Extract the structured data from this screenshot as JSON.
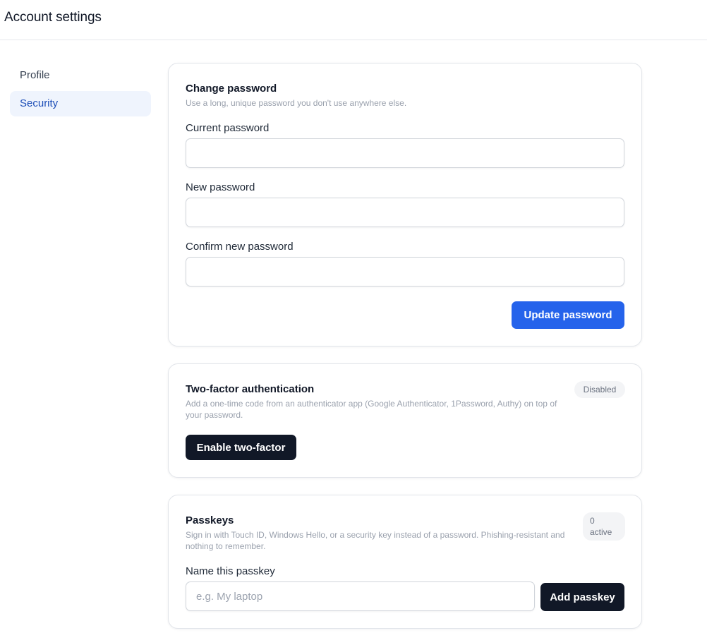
{
  "header": {
    "title": "Account settings"
  },
  "sidebar": {
    "items": [
      {
        "label": "Profile"
      },
      {
        "label": "Security"
      }
    ]
  },
  "change_password": {
    "title": "Change password",
    "description": "Use a long, unique password you don't use anywhere else.",
    "current_label": "Current password",
    "current_value": "",
    "new_label": "New password",
    "new_value": "",
    "confirm_label": "Confirm new password",
    "confirm_value": "",
    "submit_label": "Update password"
  },
  "two_factor": {
    "title": "Two-factor authentication",
    "description": "Add a one-time code from an authenticator app (Google Authenticator, 1Password, Authy) on top of your password.",
    "status": "Disabled",
    "button_label": "Enable two-factor"
  },
  "passkeys": {
    "title": "Passkeys",
    "description": "Sign in with Touch ID, Windows Hello, or a security key instead of a password. Phishing-resistant and nothing to remember.",
    "count": "0",
    "count_suffix": "active",
    "name_label": "Name this passkey",
    "name_value": "",
    "name_placeholder": "e.g. My laptop",
    "add_label": "Add passkey"
  },
  "colors": {
    "primary": "#2563eb",
    "dark_button": "#111827",
    "active_nav_bg": "#eff4fd",
    "active_nav_text": "#1e4fb8"
  }
}
